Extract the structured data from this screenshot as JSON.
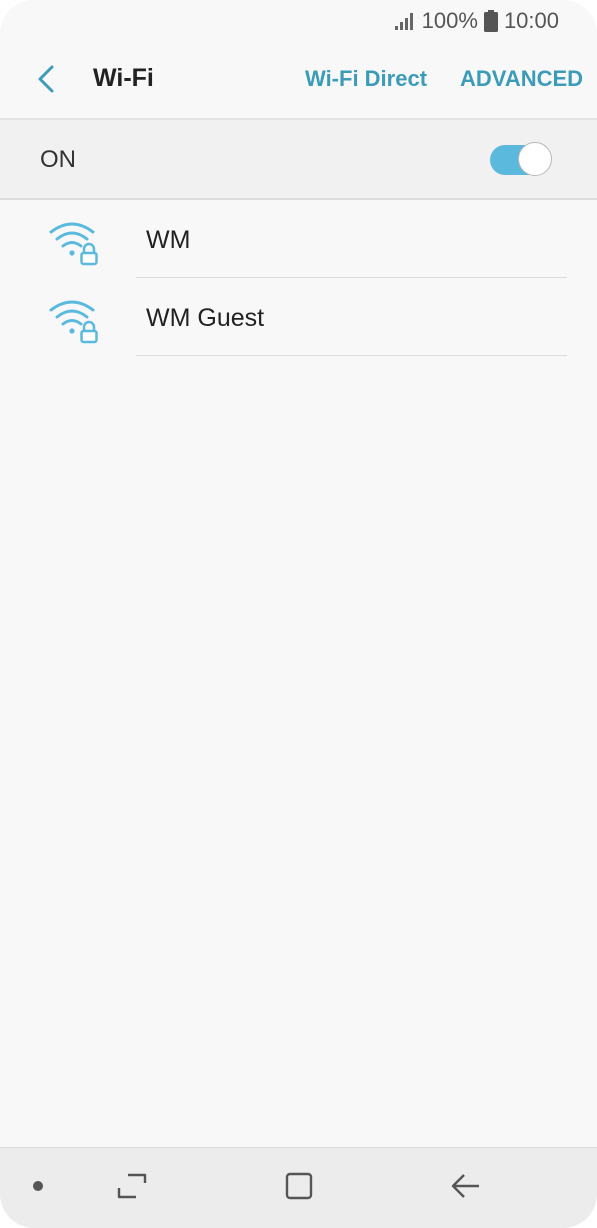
{
  "status_bar": {
    "battery_percent": "100%",
    "time": "10:00",
    "icons": [
      "signal-icon",
      "battery-icon"
    ]
  },
  "app_bar": {
    "title": "Wi-Fi",
    "wifi_direct_label": "Wi-Fi Direct",
    "advanced_label": "ADVANCED",
    "icons": [
      "back-arrow-icon"
    ]
  },
  "master_switch": {
    "label": "ON",
    "enabled": true
  },
  "networks": [
    {
      "name": "WM",
      "secured": true,
      "icon": "wifi-lock-icon"
    },
    {
      "name": "WM Guest",
      "secured": true,
      "icon": "wifi-lock-icon"
    }
  ],
  "nav_bar": {
    "icons": [
      "nav-dot-icon",
      "recents-icon",
      "home-icon",
      "back-icon"
    ]
  },
  "colors": {
    "accent": "#3c9cb8",
    "toggle_on": "#5ab9dc",
    "wifi_icon": "#5ab9dc",
    "background": "#f8f8f8"
  }
}
